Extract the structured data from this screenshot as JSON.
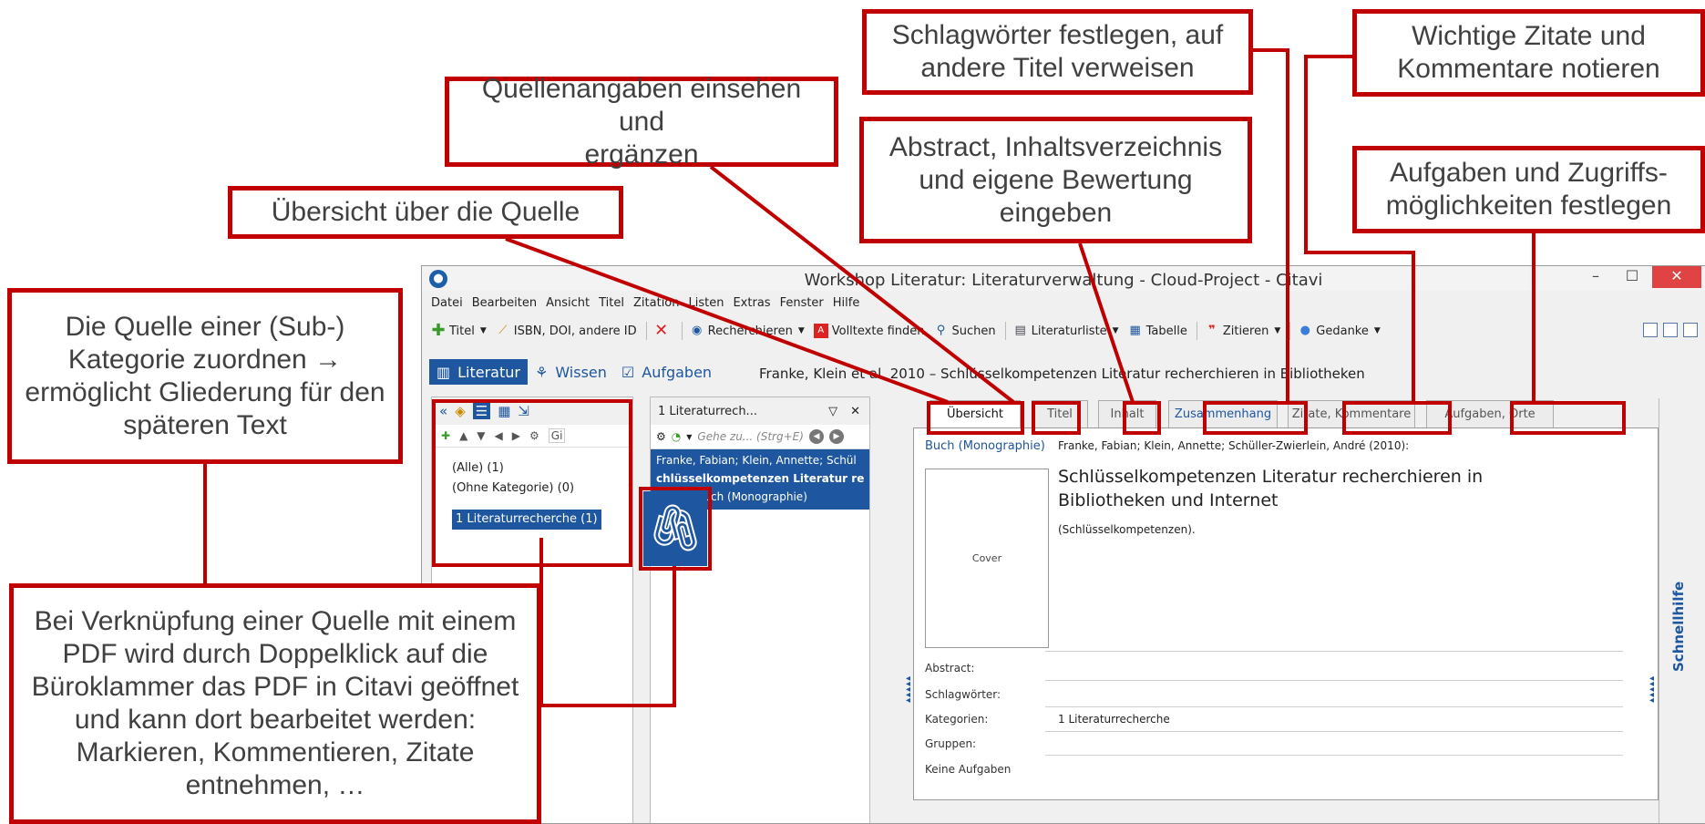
{
  "callouts": {
    "schlagwoerter": "Schlagwörter festlegen, auf\nandere Titel verweisen",
    "zitate": "Wichtige Zitate und\nKommentare notieren",
    "quellenangaben": "Quellenangaben einsehen und\nergänzen",
    "abstract": "Abstract, Inhaltsverzeichnis\nund eigene Bewertung\neingeben",
    "aufgaben": "Aufgaben und Zugriffs-\nmöglichkeiten festlegen",
    "uebersicht": "Übersicht über die Quelle",
    "kategorie": "Die Quelle einer (Sub-)\nKategorie zuordnen →\nermöglicht Gliederung für den\nspäteren Text",
    "pdf": "Bei Verknüpfung einer Quelle mit einem\nPDF wird durch Doppelklick auf die\nBüroklammer das PDF in Citavi geöffnet\nund kann dort bearbeitet werden:\nMarkieren, Kommentieren, Zitate\nentnehmen, …"
  },
  "window": {
    "title": "Workshop Literatur: Literaturverwaltung - Cloud-Project - Citavi",
    "logo": "●",
    "min": "–",
    "max": "☐",
    "close": "✕"
  },
  "menu": [
    "Datei",
    "Bearbeiten",
    "Ansicht",
    "Titel",
    "Zitation",
    "Listen",
    "Extras",
    "Fenster",
    "Hilfe"
  ],
  "toolbar": {
    "titel": "Titel",
    "isbn": "ISBN, DOI, andere ID",
    "recherchieren": "Recherchieren",
    "volltexte": "Volltexte finden",
    "suchen": "Suchen",
    "literaturliste": "Literaturliste",
    "tabelle": "Tabelle",
    "zitieren": "Zitieren",
    "gedanke": "Gedanke"
  },
  "modes": {
    "literatur": "Literatur",
    "wissen": "Wissen",
    "aufgaben": "Aufgaben"
  },
  "ref_header": "Franke, Klein et al. 2010 – Schlüsselkompetenzen Literatur recherchieren in Bibliotheken",
  "categories": {
    "all": "(Alle) (1)",
    "none": "(Ohne Kategorie) (0)",
    "selected": "1 Literaturrecherche (1)",
    "filter_placeholder": "Gi"
  },
  "mid": {
    "header": "1 Literaturrech...",
    "goto": "Gehe zu... (Strg+E)",
    "line1": "Franke, Fabian; Klein, Annette; Schül",
    "line2": "chlüsselkompetenzen Literatur re",
    "line3": "2010 – Buch (Monographie)"
  },
  "tabs": {
    "uebersicht": "Übersicht",
    "titel": "Titel",
    "inhalt": "Inhalt",
    "zusammenhang": "Zusammenhang",
    "zitate": "Zitate, Kommentare",
    "aufgaben": "Aufgaben, Orte"
  },
  "detail": {
    "type": "Buch (Monographie)",
    "authors": "Franke, Fabian; Klein, Annette; Schüller-Zwierlein, André (2010):",
    "title": "Schlüsselkompetenzen Literatur recherchieren in Bibliotheken und Internet",
    "series": "(Schlüsselkompetenzen).",
    "cover": "Cover",
    "abstract": "Abstract:",
    "schlagwoerter": "Schlagwörter:",
    "kategorien": "Kategorien:",
    "kategorien_value": "1 Literaturrecherche",
    "gruppen": "Gruppen:",
    "keine_aufgaben": "Keine Aufgaben"
  },
  "quickhelp": "Schnellhilfe",
  "colors": {
    "accent_red": "#c00000",
    "citavi_blue": "#1e56a0"
  }
}
